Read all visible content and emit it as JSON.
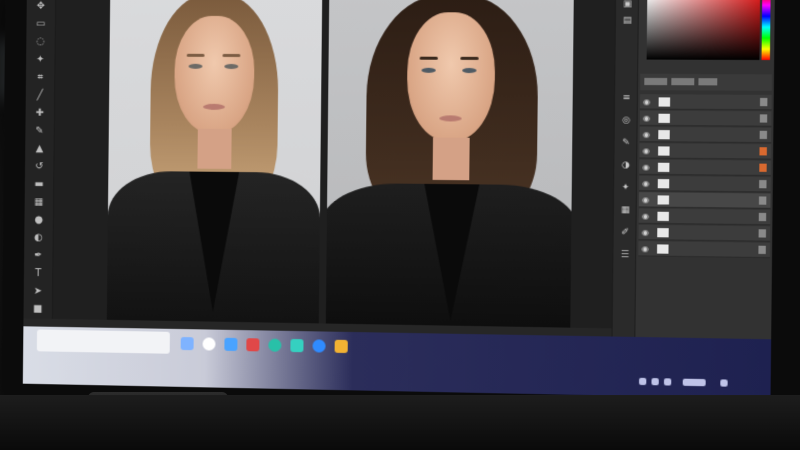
{
  "scene": {
    "description_colors": {
      "bezel": "#0b0b0b",
      "app_bg": "#2b2b2b",
      "taskbar_dark": "#1e2150",
      "accent_orange": "#d9692f"
    }
  },
  "toolbar": {
    "tools": [
      "move-icon",
      "marquee-icon",
      "lasso-icon",
      "magic-wand-icon",
      "crop-icon",
      "eyedropper-icon",
      "healing-icon",
      "brush-icon",
      "clone-stamp-icon",
      "history-brush-icon",
      "eraser-icon",
      "gradient-icon",
      "blur-icon",
      "dodge-icon",
      "pen-icon",
      "type-icon",
      "path-select-icon",
      "shape-icon",
      "hand-icon",
      "zoom-icon"
    ]
  },
  "canvas": {
    "photos": [
      "left-portrait",
      "right-portrait"
    ]
  },
  "panel": {
    "colors": {
      "hue_top": "#ff0000",
      "picker_base": "#e61e1e"
    },
    "layers": [
      {
        "visible": true,
        "locked": false
      },
      {
        "visible": true,
        "locked": false
      },
      {
        "visible": true,
        "locked": false
      },
      {
        "visible": true,
        "locked": true
      },
      {
        "visible": true,
        "locked": true
      },
      {
        "visible": true,
        "locked": false
      },
      {
        "visible": true,
        "locked": false
      },
      {
        "visible": true,
        "locked": false
      },
      {
        "visible": true,
        "locked": false
      },
      {
        "visible": true,
        "locked": false
      }
    ]
  },
  "taskbar": {
    "icons": [
      "start-icon",
      "widgets-icon",
      "store-icon",
      "office-icon",
      "edge-icon",
      "teams-icon",
      "mail-icon",
      "files-icon"
    ]
  }
}
